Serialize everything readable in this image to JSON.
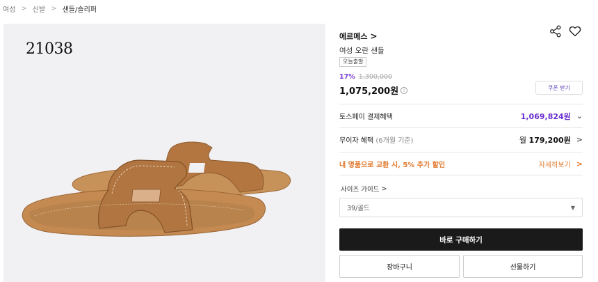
{
  "breadcrumb": {
    "items": [
      "여성",
      "신발",
      "샌들/슬리퍼"
    ],
    "separator": ">"
  },
  "image": {
    "code": "21038",
    "description_icon": "sandal-product-photo"
  },
  "product": {
    "brand": "에르메스",
    "brand_chevron": ">",
    "name": "여성 오란 샌들",
    "tag": "오늘출발",
    "discount_pct": "17%",
    "original_price": "1,300,000",
    "price": "1,075,200원",
    "price_info_icon": "i",
    "coupon_label": "쿠폰 받기"
  },
  "rows": {
    "toss_label": "토스페이 결제혜택",
    "toss_value": "1,069,824원",
    "toss_chevron": "⌄",
    "installment_label": "무이자 혜택",
    "installment_sub": "(6개월 기준)",
    "installment_prefix": "월",
    "installment_value": "179,200원",
    "installment_chevron": ">",
    "trade_label": "내 명품으로 교환 시, 5% 추가 할인",
    "trade_value": "자세히보기",
    "trade_chevron": ">"
  },
  "size": {
    "guide_label": "사이즈 가이드",
    "guide_chevron": ">",
    "selected": "39/골드",
    "caret": "▼"
  },
  "actions": {
    "buy_label": "바로 구매하기",
    "cart_label": "장바구니",
    "gift_label": "선물하기"
  },
  "colors": {
    "accent_purple": "#6b2fd0",
    "accent_orange": "#e0772a",
    "sandal_leather": "#b0753f",
    "background_panel": "#f1f1f3"
  }
}
